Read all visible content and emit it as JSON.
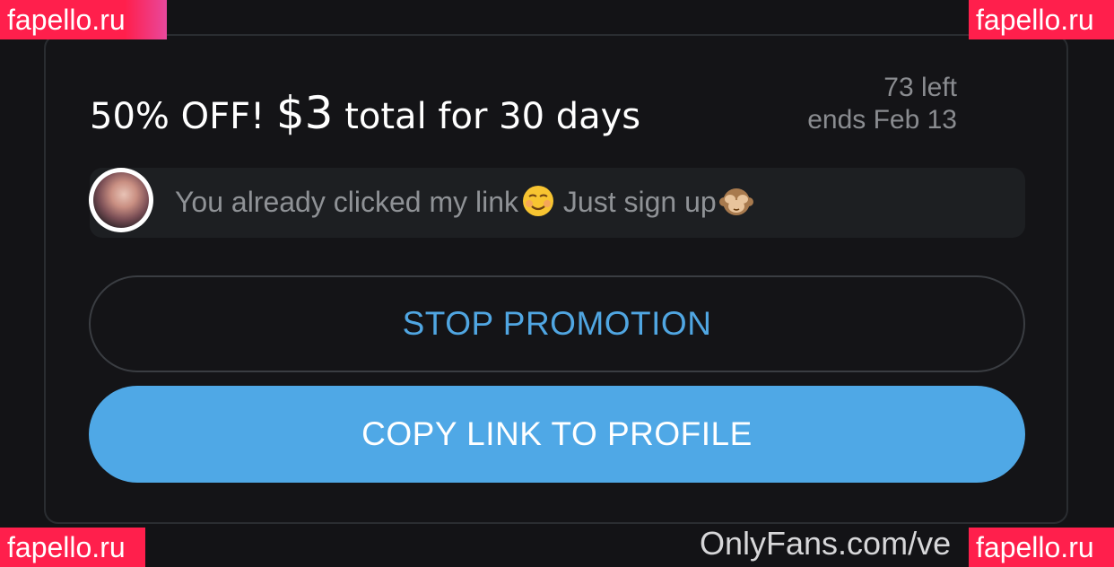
{
  "promotion": {
    "title_prefix": "50% OFF!",
    "price": "$3",
    "title_suffix": "total for 30 days",
    "remaining": "73 left",
    "ends": "ends Feb 13"
  },
  "message": {
    "text_part1": "You already clicked my link",
    "emoji1": "☺️",
    "text_part2": " Just sign up",
    "emoji2": "🙈"
  },
  "buttons": {
    "stop_label": "STOP PROMOTION",
    "copy_label": "COPY LINK TO PROFILE"
  },
  "footer": {
    "text": "OnlyFans.com/ve"
  },
  "watermarks": {
    "top_left": "fapello.ru",
    "top_right": "fapello.ru",
    "bottom_left": "fapello.ru",
    "bottom_right": "fapello.ru"
  },
  "colors": {
    "background": "#131316",
    "accent": "#4fa8e6",
    "accent_text": "#50a6e2",
    "watermark": "#ff1f4c"
  }
}
